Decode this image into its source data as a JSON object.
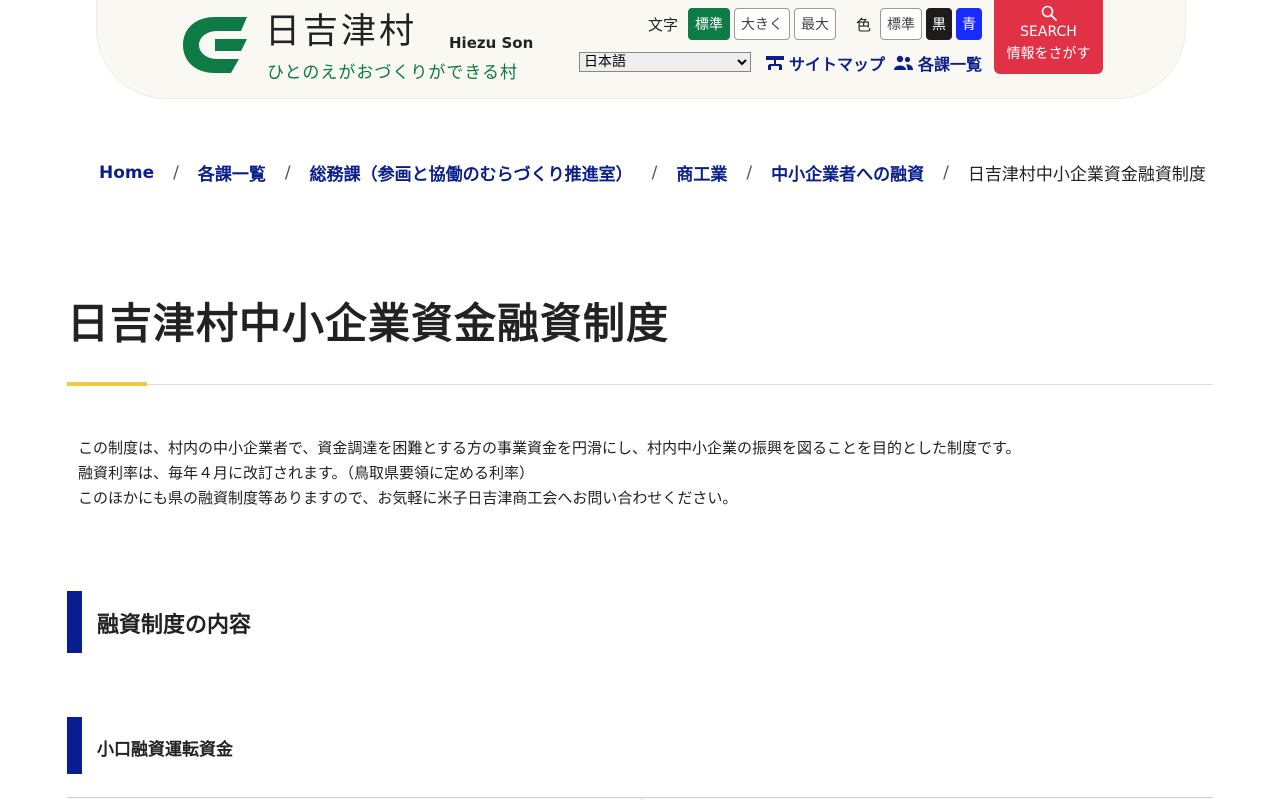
{
  "site": {
    "name": "日吉津村",
    "name_en": "Hiezu Son",
    "tagline_parts": [
      "ひとの",
      "え",
      "がお",
      "づ",
      "くりができる",
      "村"
    ],
    "brand_green": "#0e7a45"
  },
  "header": {
    "text_size_label": "文字",
    "text_size_buttons": [
      "標準",
      "大きく",
      "最大"
    ],
    "color_label": "色",
    "color_buttons": [
      "標準",
      "黒",
      "青"
    ],
    "language_selected": "日本語",
    "sitemap_label": "サイトマップ",
    "sitemap_icon": "sitemap-icon",
    "departments_label": "各課一覧",
    "departments_icon": "people-icon",
    "search_label": "SEARCH",
    "search_sub": "情報をさがす",
    "search_icon": "search-icon",
    "search_color": "#e03146"
  },
  "breadcrumb": {
    "items": [
      "Home",
      "各課一覧",
      "総務課（参画と協働のむらづくり推進室）",
      "商工業",
      "中小企業者への融資"
    ],
    "current": "日吉津村中小企業資金融資制度"
  },
  "main": {
    "title": "日吉津村中小企業資金融資制度",
    "intro": [
      "この制度は、村内の中小企業者で、資金調達を困難とする方の事業資金を円滑にし、村内中小企業の振興を図ることを目的とした制度です。",
      "融資利率は、毎年４月に改訂されます。（鳥取県要領に定める利率）",
      "このほかにも県の融資制度等ありますので、お気軽に米子日吉津商工会へお問い合わせください。"
    ],
    "section_heading": "融資制度の内容",
    "subsection_heading": "小口融資運転資金",
    "accent_color": "#0a1f8f"
  }
}
